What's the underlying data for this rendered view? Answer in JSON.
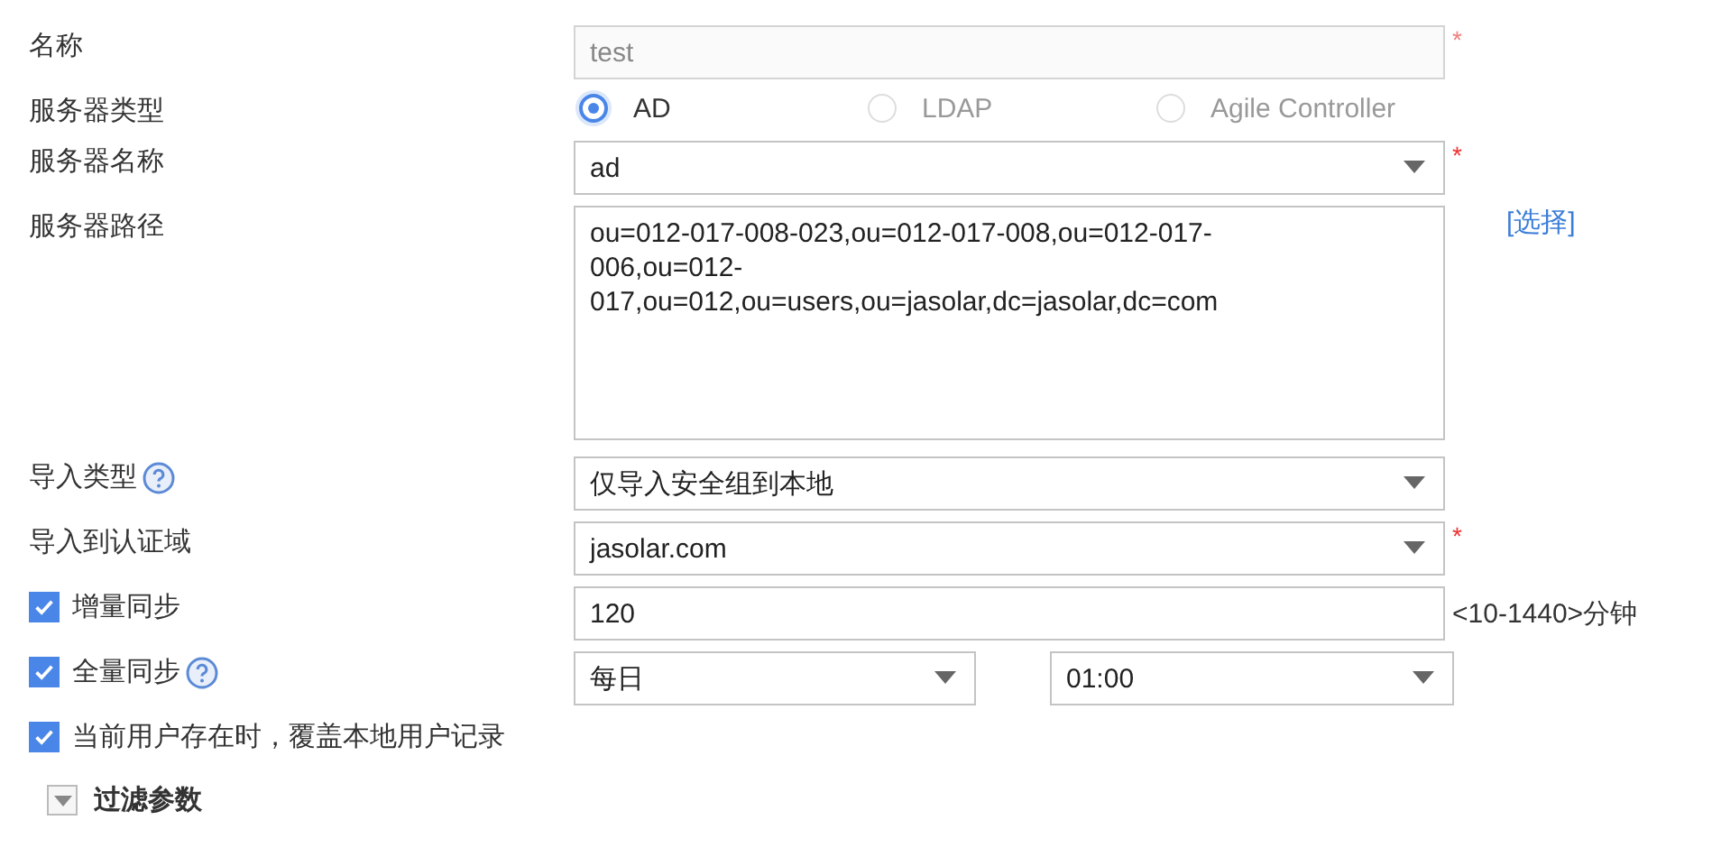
{
  "fields": [
    {
      "label": "名称",
      "kind": "text",
      "value": "test",
      "disabled": true,
      "required_mark": "*"
    },
    {
      "label": "服务器类型",
      "kind": "radio",
      "options": [
        {
          "label": "AD",
          "selected": true,
          "disabled": false
        },
        {
          "label": "LDAP",
          "selected": false,
          "disabled": true
        },
        {
          "label": "Agile Controller",
          "selected": false,
          "disabled": true
        }
      ]
    },
    {
      "label": "服务器名称",
      "kind": "select",
      "value": "ad",
      "required_mark": "*"
    },
    {
      "label": "服务器路径",
      "kind": "textarea",
      "value": "ou=012-017-008-023,ou=012-017-008,ou=012-017-006,ou=012-017,ou=012,ou=users,ou=jasolar,dc=jasolar,dc=com",
      "link": "[选择]"
    },
    {
      "label": "导入类型",
      "kind": "select",
      "value": "仅导入安全组到本地",
      "help": true
    },
    {
      "label": "导入到认证域",
      "kind": "select",
      "value": "jasolar.com",
      "required_mark": "*"
    },
    {
      "label": "增量同步",
      "kind": "text",
      "value": "120",
      "checked": true,
      "suffix": "<10-1440>分钟"
    },
    {
      "label": "全量同步",
      "kind": "selects",
      "values": [
        "每日",
        "01:00"
      ],
      "checked": true,
      "help": true
    },
    {
      "label": "当前用户存在时，覆盖本地用户记录",
      "kind": "checkbox",
      "checked": true
    }
  ],
  "filter": {
    "label": "过滤参数",
    "expanded": false
  }
}
